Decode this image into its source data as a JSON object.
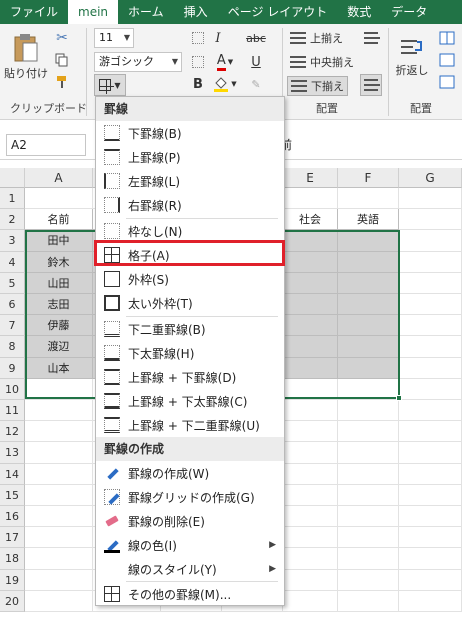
{
  "ribbon_tabs": [
    "ファイル",
    "mein",
    "ホーム",
    "挿入",
    "ページ レイアウト",
    "数式",
    "データ"
  ],
  "ribbon": {
    "paste_label": "貼り付け",
    "clipboard_group": "クリップボード",
    "font_size": "11",
    "font_name": "游ゴシック",
    "bold": "B",
    "italic": "I",
    "underline": "U",
    "strike": "abc",
    "font_color_letter": "A",
    "align_top": "上揃え",
    "align_middle": "中央揃え",
    "align_bottom": "下揃え",
    "wrap_label": "折返し",
    "align_group": "配置",
    "align_group_2": "配置"
  },
  "formula_bar": {
    "name_box": "A2",
    "content": "前"
  },
  "columns": [
    "A",
    "B",
    "C",
    "D",
    "E",
    "F",
    "G"
  ],
  "rows": [
    "1",
    "2",
    "3",
    "4",
    "5",
    "6",
    "7",
    "8",
    "9",
    "10",
    "11",
    "12",
    "13",
    "14",
    "15",
    "16",
    "17",
    "18",
    "19",
    "20"
  ],
  "cells": {
    "A2": "名前",
    "A3": "田中",
    "A4": "鈴木",
    "A5": "山田",
    "A6": "志田",
    "A7": "伊藤",
    "A8": "渡辺",
    "A9": "山本",
    "E2": "社会",
    "F2": "英語"
  },
  "menu": {
    "section_borders": "罫線",
    "section_draw": "罫線の作成",
    "items": {
      "bottom": "下罫線(B)",
      "top": "上罫線(P)",
      "left": "左罫線(L)",
      "right": "右罫線(R)",
      "none": "枠なし(N)",
      "all": "格子(A)",
      "outside": "外枠(S)",
      "thick_box": "太い外枠(T)",
      "bottom_double": "下二重罫線(B)",
      "thick_bottom": "下太罫線(H)",
      "top_bottom": "上罫線 + 下罫線(D)",
      "top_thick_bottom": "上罫線 + 下太罫線(C)",
      "top_double_bottom": "上罫線 + 下二重罫線(U)",
      "draw_border": "罫線の作成(W)",
      "draw_grid": "罫線グリッドの作成(G)",
      "erase": "罫線の削除(E)",
      "line_color": "線の色(I)",
      "line_style": "線のスタイル(Y)",
      "more": "その他の罫線(M)..."
    }
  },
  "colors": {
    "excel_green": "#217346",
    "highlight_red": "#e0202a",
    "selection_gray": "#d2d2d2"
  }
}
